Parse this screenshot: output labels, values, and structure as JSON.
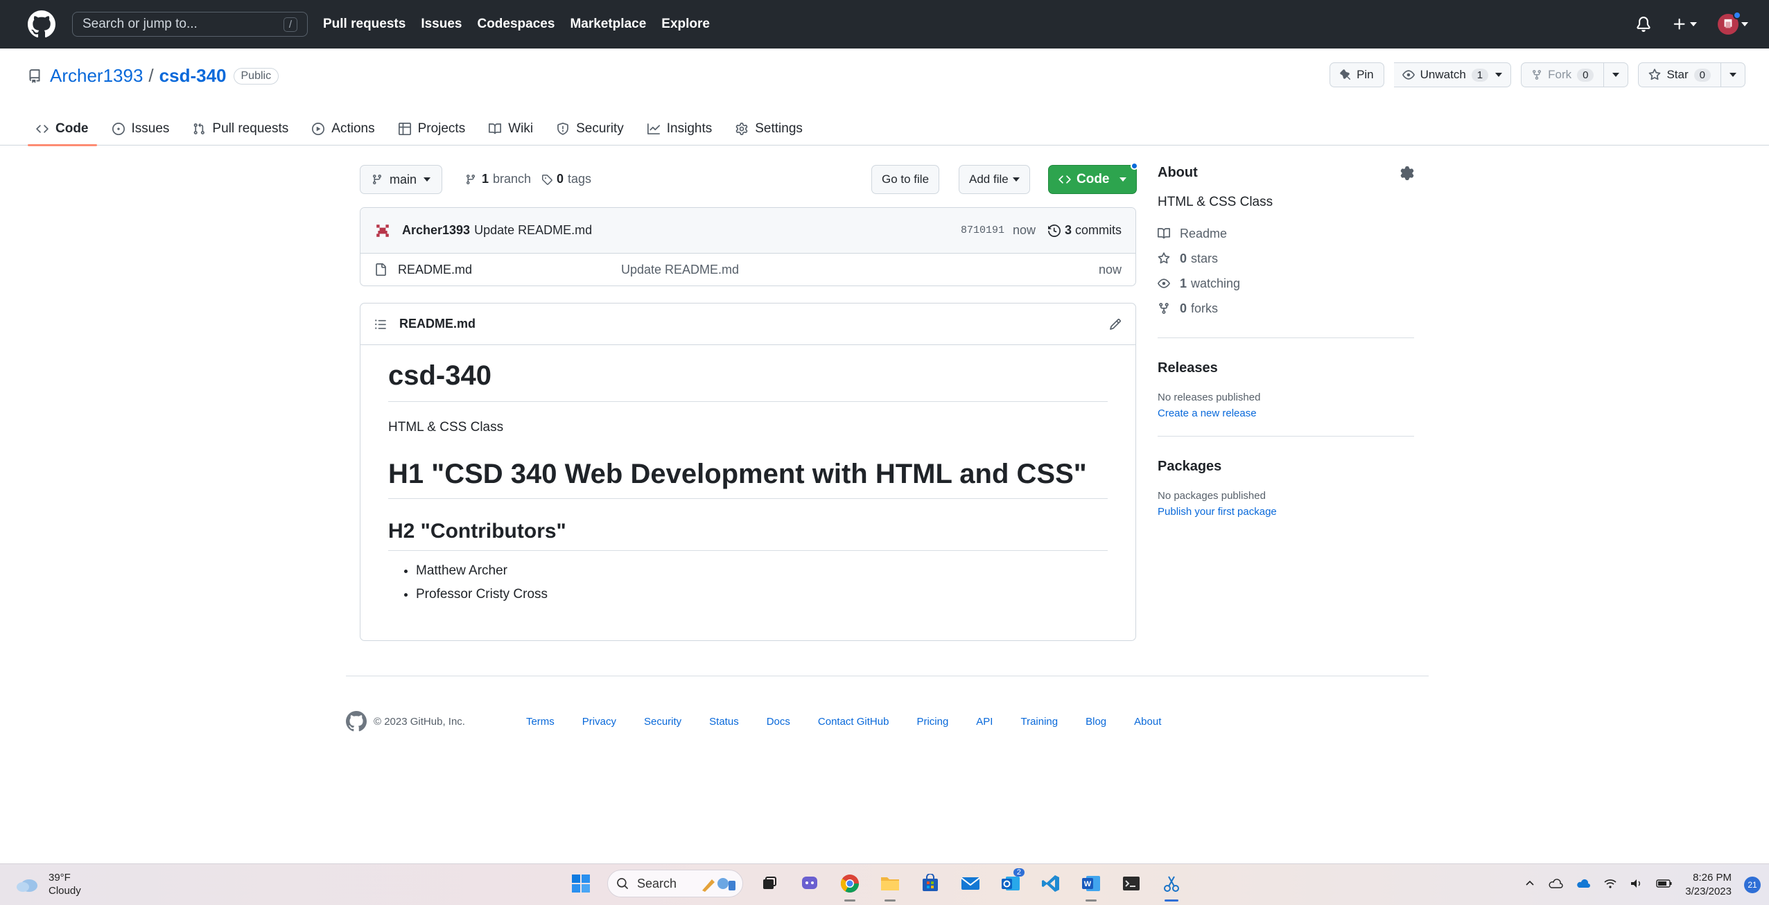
{
  "header": {
    "search_placeholder": "Search or jump to...",
    "search_shortcut": "/",
    "nav": [
      "Pull requests",
      "Issues",
      "Codespaces",
      "Marketplace",
      "Explore"
    ]
  },
  "repo": {
    "owner": "Archer1393",
    "separator": "/",
    "name": "csd-340",
    "visibility": "Public",
    "pin_label": "Pin",
    "unwatch_label": "Unwatch",
    "unwatch_count": "1",
    "fork_label": "Fork",
    "fork_count": "0",
    "star_label": "Star",
    "star_count": "0"
  },
  "tabs": [
    "Code",
    "Issues",
    "Pull requests",
    "Actions",
    "Projects",
    "Wiki",
    "Security",
    "Insights",
    "Settings"
  ],
  "file_nav": {
    "branch": "main",
    "branch_count": "1",
    "branch_label": "branch",
    "tag_count": "0",
    "tag_label": "tags",
    "go_to_file": "Go to file",
    "add_file": "Add file",
    "code": "Code"
  },
  "commit": {
    "author": "Archer1393",
    "message": "Update README.md",
    "sha": "8710191",
    "age": "now",
    "count": "3",
    "count_label": "commits"
  },
  "files": [
    {
      "name": "README.md",
      "message": "Update README.md",
      "age": "now"
    }
  ],
  "readme": {
    "filename": "README.md",
    "h1": "csd-340",
    "paragraph": "HTML & CSS Class",
    "h1_second": "H1 \"CSD 340 Web Development with HTML and CSS\"",
    "h2": "H2 \"Contributors\"",
    "contributors": [
      "Matthew Archer",
      "Professor Cristy Cross"
    ]
  },
  "sidebar": {
    "about_title": "About",
    "description": "HTML & CSS Class",
    "readme_label": "Readme",
    "stars_count": "0",
    "stars_label": "stars",
    "watching_count": "1",
    "watching_label": "watching",
    "forks_count": "0",
    "forks_label": "forks",
    "releases_title": "Releases",
    "releases_none": "No releases published",
    "releases_link": "Create a new release",
    "packages_title": "Packages",
    "packages_none": "No packages published",
    "packages_link": "Publish your first package"
  },
  "footer": {
    "copyright": "© 2023 GitHub, Inc.",
    "links": [
      "Terms",
      "Privacy",
      "Security",
      "Status",
      "Docs",
      "Contact GitHub",
      "Pricing",
      "API",
      "Training",
      "Blog",
      "About"
    ]
  },
  "taskbar": {
    "temperature": "39°F",
    "condition": "Cloudy",
    "search_label": "Search",
    "teams_badge": "2",
    "time": "8:26 PM",
    "date": "3/23/2023",
    "notifications": "21"
  },
  "colors": {
    "header_bg": "#24292f",
    "link": "#0969da",
    "code_button": "#2da44e",
    "active_tab_underline": "#fd8c73"
  }
}
